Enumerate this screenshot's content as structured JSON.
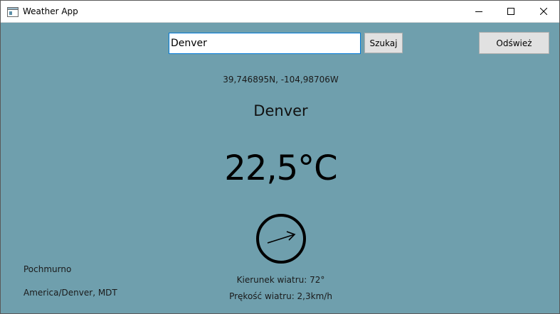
{
  "window": {
    "title": "Weather App",
    "icon": "app-window-icon",
    "controls": [
      "minimize-icon",
      "maximize-icon",
      "close-icon"
    ]
  },
  "search": {
    "value": "Denver",
    "button_label": "Szukaj"
  },
  "toolbar": {
    "refresh_label": "Odśwież"
  },
  "weather": {
    "coordinates": "39,746895N, -104,98706W",
    "city": "Denver",
    "temperature": "22,5°C",
    "wind_direction_deg": 72,
    "wind_direction_text": "Kierunek wiatru: 72°",
    "wind_speed_text": "Prękość wiatru: 2,3km/h",
    "condition": "Pochmurno",
    "timezone": "America/Denver, MDT"
  },
  "colors": {
    "background": "#6f9fad",
    "input_focus_border": "#0078d7",
    "button_face": "#e1e1e1"
  }
}
